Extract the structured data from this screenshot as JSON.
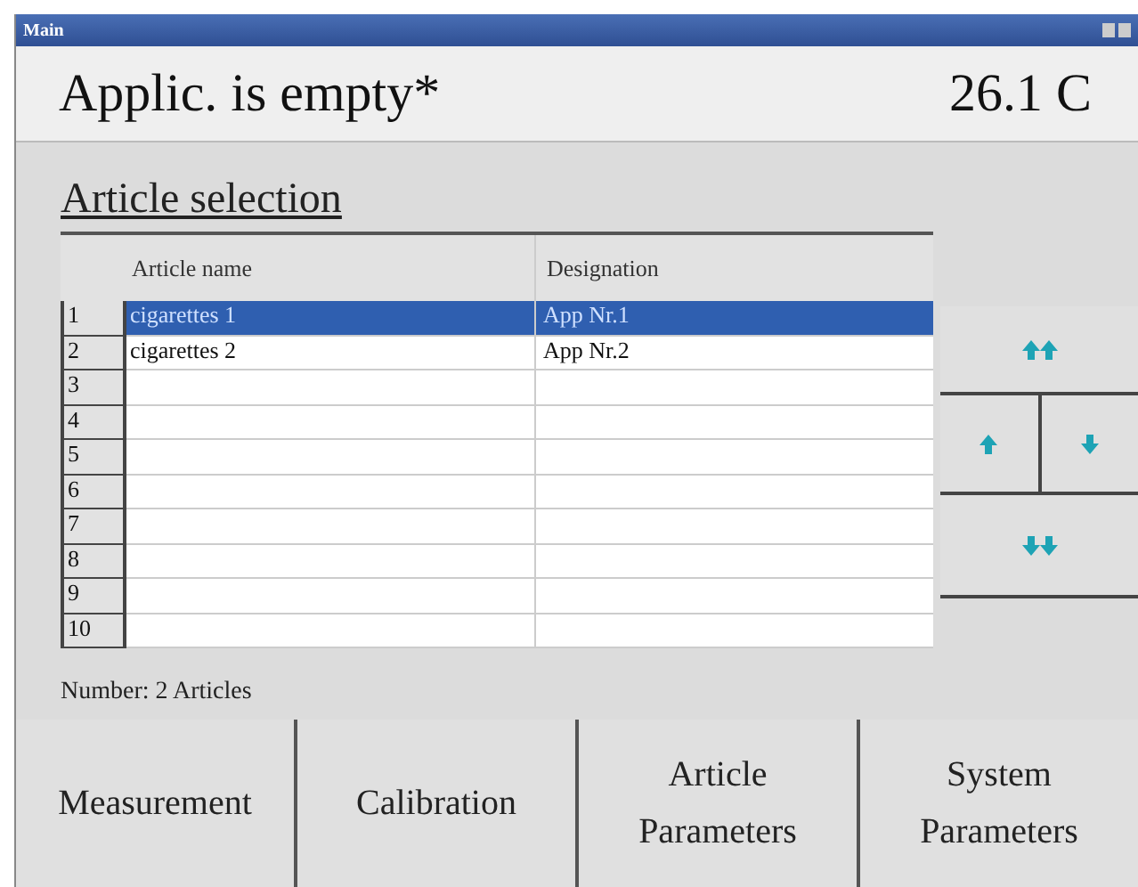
{
  "window": {
    "title": "Main"
  },
  "header": {
    "status": "Applic. is empty*",
    "temperature": "26.1 C"
  },
  "section_title": "Article selection",
  "table": {
    "columns": [
      "Article name",
      "Designation"
    ],
    "rows": [
      {
        "number": "1",
        "cells": [
          "cigarettes 1",
          "App Nr.1"
        ],
        "selected": true
      },
      {
        "number": "2",
        "cells": [
          "cigarettes 2",
          "App Nr.2"
        ],
        "selected": false
      },
      {
        "number": "3",
        "cells": [],
        "selected": false
      },
      {
        "number": "4",
        "cells": [],
        "selected": false
      },
      {
        "number": "5",
        "cells": [],
        "selected": false
      },
      {
        "number": "6",
        "cells": [],
        "selected": false
      },
      {
        "number": "7",
        "cells": [],
        "selected": false
      },
      {
        "number": "8",
        "cells": [],
        "selected": false
      },
      {
        "number": "9",
        "cells": [],
        "selected": false
      },
      {
        "number": "10",
        "cells": [],
        "selected": false
      }
    ]
  },
  "count": "Number: 2 Articles",
  "nav_buttons": [
    {
      "kind": "first"
    },
    {
      "kind": "up"
    },
    {
      "kind": "down"
    },
    {
      "kind": "last"
    }
  ],
  "bottom_buttons": [
    {
      "lines": [
        "Measurement"
      ]
    },
    {
      "lines": [
        "Calibration"
      ]
    },
    {
      "lines": [
        "Article",
        "Parameters"
      ]
    },
    {
      "lines": [
        "System",
        "Parameters"
      ]
    }
  ]
}
